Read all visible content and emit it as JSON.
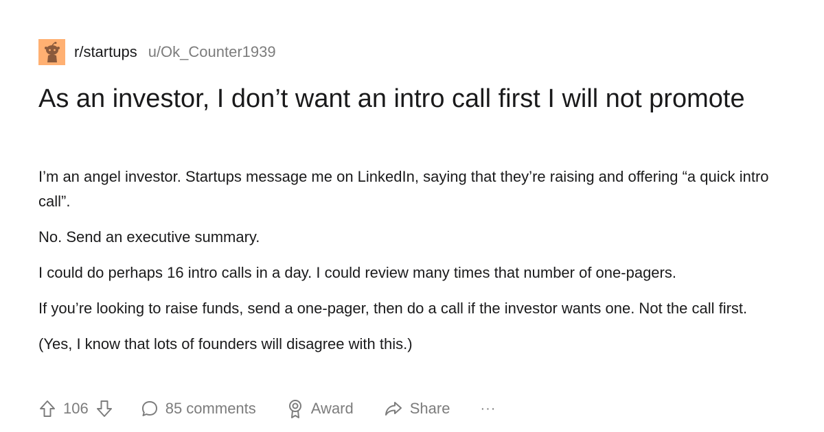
{
  "post": {
    "subreddit": "r/startups",
    "username": "u/Ok_Counter1939",
    "title": "As an investor, I don’t want an intro call first I will not promote",
    "paragraphs": [
      "I’m an angel investor. Startups message me on LinkedIn, saying that they’re raising and offering “a quick intro call”.",
      "No. Send an executive summary.",
      "I could do perhaps 16 intro calls in a day. I could review many times that number of one-pagers.",
      "If you’re looking to raise funds, send a one-pager, then do a call if the investor wants one. Not the call first.",
      "(Yes, I know that lots of founders will disagree with this.)"
    ]
  },
  "actions": {
    "votes": "106",
    "comments": "85 comments",
    "award": "Award",
    "share": "Share",
    "more": "···"
  },
  "icons": {
    "avatar": "reddit-snoo-icon",
    "upvote": "arrow-up-icon",
    "downvote": "arrow-down-icon",
    "comments": "speech-bubble-icon",
    "award": "award-ribbon-icon",
    "share": "share-arrow-icon"
  },
  "colors": {
    "avatar_bg": "#ffb072",
    "text": "#1a1a1b",
    "muted": "#7c7c7c"
  }
}
